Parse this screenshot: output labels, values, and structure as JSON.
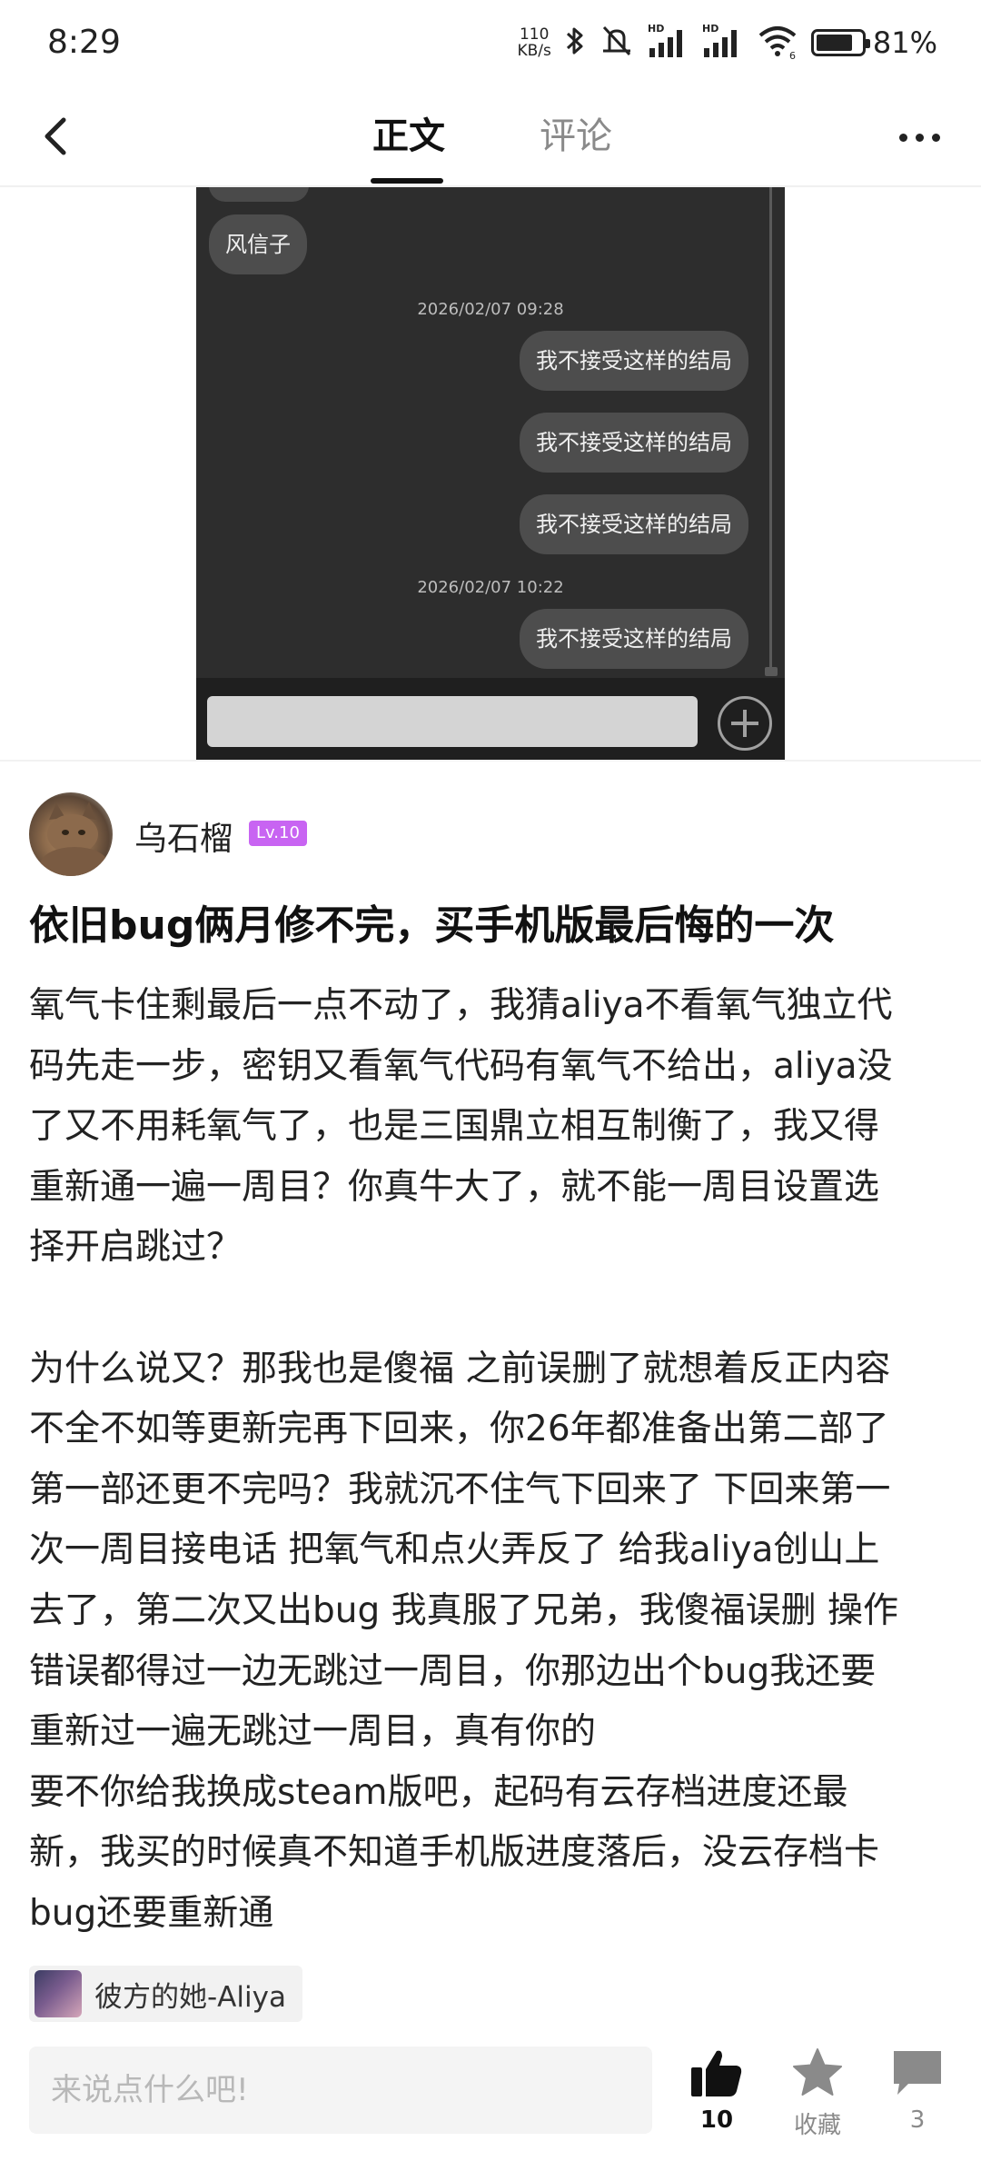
{
  "status_bar": {
    "time": "8:29",
    "net_speed_value": "110",
    "net_speed_unit": "KB/s",
    "hd1": "HD",
    "hd2": "HD",
    "wifi_badge": "6",
    "battery_percent": "81%",
    "battery_level": 0.81
  },
  "nav": {
    "tabs": [
      {
        "label": "正文",
        "active": true
      },
      {
        "label": "评论",
        "active": false
      }
    ]
  },
  "chat_screenshot": {
    "top_bubble": "风信子",
    "timestamps": [
      "2026/02/07  09:28",
      "2026/02/07  10:22"
    ],
    "messages": [
      "我不接受这样的结局",
      "我不接受这样的结局",
      "我不接受这样的结局",
      "我不接受这样的结局"
    ]
  },
  "author": {
    "name": "乌石榴",
    "level": "Lv.10"
  },
  "post": {
    "title": "依旧bug俩月修不完，买手机版最后悔的一次",
    "lines": [
      "氧气卡住剩最后一点不动了，我猜aliya不看氧气独立代",
      "码先走一步，密钥又看氧气代码有氧气不给出，aliya没",
      "了又不用耗氧气了，也是三国鼎立相互制衡了，我又得",
      "重新通一遍一周目？你真牛大了，就不能一周目设置选",
      "择开启跳过？",
      "",
      "为什么说又？那我也是傻福 之前误删了就想着反正内容",
      "不全不如等更新完再下回来，你26年都准备出第二部了",
      "第一部还更不完吗？我就沉不住气下回来了 下回来第一",
      "次一周目接电话 把氧气和点火弄反了 给我aliya创山上",
      "去了，第二次又出bug 我真服了兄弟，我傻福误删 操作",
      "错误都得过一边无跳过一周目，你那边出个bug我还要",
      "重新过一遍无跳过一周目，真有你的",
      "要不你给我换成steam版吧，起码有云存档进度还最",
      "新，我买的时候真不知道手机版进度落后，没云存档卡",
      "bug还要重新通"
    ]
  },
  "game_tag": {
    "name": "彼方的她-Aliya"
  },
  "bottom_bar": {
    "comment_placeholder": "来说点什么吧!",
    "like_count": "10",
    "favorite_label": "收藏",
    "comment_count": "3"
  }
}
